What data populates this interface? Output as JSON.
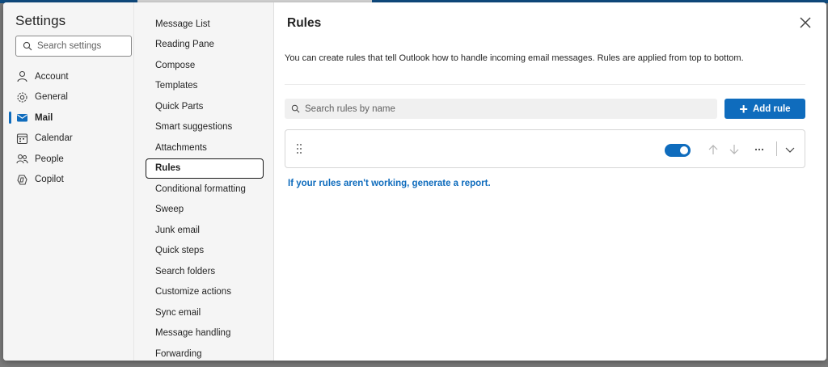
{
  "colors": {
    "accent": "#0f6cbd",
    "panel_bg": "#f5f5f5"
  },
  "settings": {
    "title": "Settings",
    "search_placeholder": "Search settings",
    "nav_items": [
      {
        "label": "Account",
        "icon": "person-icon"
      },
      {
        "label": "General",
        "icon": "gear-icon"
      },
      {
        "label": "Mail",
        "icon": "mail-icon",
        "active": true
      },
      {
        "label": "Calendar",
        "icon": "calendar-icon"
      },
      {
        "label": "People",
        "icon": "people-icon"
      },
      {
        "label": "Copilot",
        "icon": "copilot-icon"
      }
    ]
  },
  "mail_sections": [
    "Message List",
    "Reading Pane",
    "Compose",
    "Templates",
    "Quick Parts",
    "Smart suggestions",
    "Attachments",
    "Rules",
    "Conditional formatting",
    "Sweep",
    "Junk email",
    "Quick steps",
    "Search folders",
    "Customize actions",
    "Sync email",
    "Message handling",
    "Forwarding"
  ],
  "selected_section": "Rules",
  "rules_page": {
    "title": "Rules",
    "description": "You can create rules that tell Outlook how to handle incoming email messages. Rules are applied from top to bottom.",
    "search_placeholder": "Search rules by name",
    "add_button": "Add rule",
    "rule": {
      "enabled": true,
      "icons": [
        "drag-handle-icon",
        "arrow-up-icon",
        "arrow-down-icon",
        "more-icon",
        "chevron-down-icon"
      ]
    },
    "report_link": "If your rules aren't working, generate a report."
  }
}
